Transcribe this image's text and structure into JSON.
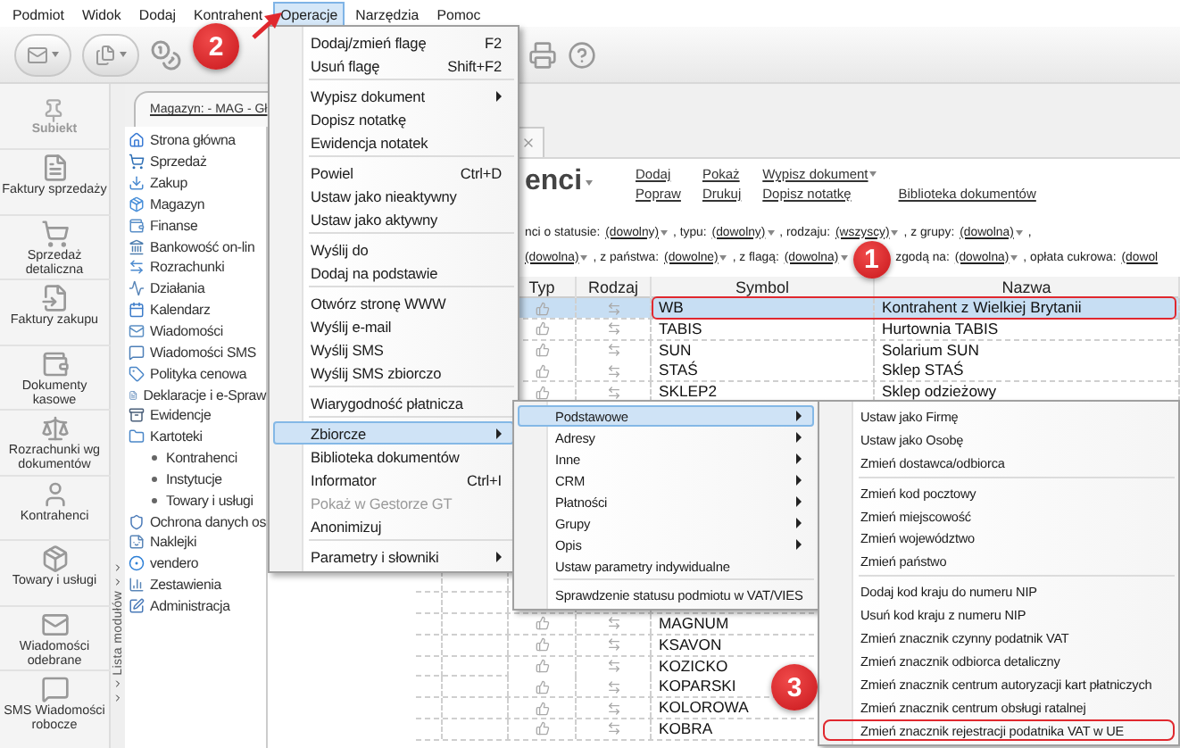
{
  "menu_bar": [
    {
      "label": "Podmiot",
      "selected": false
    },
    {
      "label": "Widok",
      "selected": false
    },
    {
      "label": "Dodaj",
      "selected": false
    },
    {
      "label": "Kontrahent",
      "selected": false
    },
    {
      "label": "Operacje",
      "selected": true
    },
    {
      "label": "Narzędzia",
      "selected": false
    },
    {
      "label": "Pomoc",
      "selected": false
    }
  ],
  "sidebar": {
    "logo_text": "Subiekt",
    "items": [
      {
        "label": "Faktury sprzedaży"
      },
      {
        "label": "Sprzedaż detaliczna"
      },
      {
        "label": "Faktury zakupu"
      },
      {
        "label": "Dokumenty kasowe"
      },
      {
        "label": "Rozrachunki wg dokumentów"
      },
      {
        "label": "Kontrahenci"
      },
      {
        "label": "Towary i usługi"
      },
      {
        "label": "Wiadomości odebrane"
      },
      {
        "label": "SMS Wiadomości robocze"
      }
    ]
  },
  "module_strip": {
    "label": "Lista modułów"
  },
  "tab": {
    "label": "Magazyn: - MAG - Gł"
  },
  "module_tree": [
    {
      "label": "Strona główna"
    },
    {
      "label": "Sprzedaż"
    },
    {
      "label": "Zakup"
    },
    {
      "label": "Magazyn"
    },
    {
      "label": "Finanse"
    },
    {
      "label": "Bankowość on-lin"
    },
    {
      "label": "Rozrachunki"
    },
    {
      "label": "Działania"
    },
    {
      "label": "Kalendarz"
    },
    {
      "label": "Wiadomości"
    },
    {
      "label": "Wiadomości SMS"
    },
    {
      "label": "Polityka cenowa"
    },
    {
      "label": "Deklaracje i e-Spraw"
    },
    {
      "label": "Ewidencje"
    },
    {
      "label": "Kartoteki",
      "children": [
        {
          "label": "Kontrahenci"
        },
        {
          "label": "Instytucje"
        },
        {
          "label": "Towary i usługi"
        }
      ]
    },
    {
      "label": "Ochrona danych os"
    },
    {
      "label": "Naklejki"
    },
    {
      "label": "vendero"
    },
    {
      "label": "Zestawienia"
    },
    {
      "label": "Administracja"
    }
  ],
  "content": {
    "title": "enci",
    "action_columns": [
      [
        {
          "label": "Dodaj",
          "dropdown": false
        },
        {
          "label": "Popraw",
          "dropdown": false
        }
      ],
      [
        {
          "label": "Pokaż",
          "dropdown": false
        },
        {
          "label": "Drukuj",
          "dropdown": false
        }
      ],
      [
        {
          "label": "Wypisz dokument",
          "dropdown": true
        },
        {
          "label": "Dopisz notatkę",
          "dropdown": false
        }
      ],
      [
        {
          "label": "Biblioteka dokumentów",
          "dropdown": false
        }
      ]
    ],
    "filters": [
      [
        {
          "kind": "text",
          "text": "nci o statusie:"
        },
        {
          "kind": "dropdown",
          "text": "(dowolny)"
        },
        {
          "kind": "text",
          "text": ", typu:"
        },
        {
          "kind": "dropdown",
          "text": "(dowolny)"
        },
        {
          "kind": "text",
          "text": ", rodzaju:"
        },
        {
          "kind": "dropdown",
          "text": "(wszyscy)"
        },
        {
          "kind": "text",
          "text": ", z grupy:"
        },
        {
          "kind": "dropdown",
          "text": "(dowolna)"
        },
        {
          "kind": "text",
          "text": ","
        }
      ],
      [
        {
          "kind": "dropdown",
          "text": "(dowolna)"
        },
        {
          "kind": "text",
          "text": ", z państwa:"
        },
        {
          "kind": "dropdown",
          "text": "(dowolne)"
        },
        {
          "kind": "text",
          "text": ", z flagą:"
        },
        {
          "kind": "dropdown",
          "text": "(dowolna)"
        },
        {
          "kind": "callout",
          "label": "1"
        },
        {
          "kind": "text",
          "text": "zgodą na:"
        },
        {
          "kind": "dropdown",
          "text": "(dowolna)"
        },
        {
          "kind": "text",
          "text": ", opłata cukrowa:"
        },
        {
          "kind": "value",
          "text": "(dowol"
        }
      ]
    ]
  },
  "table": {
    "columns": [
      "Typ",
      "Rodzaj",
      "Symbol",
      "Nazwa"
    ],
    "row_groups": [
      [
        {
          "symbol": "WB",
          "name": "Kontrahent z Wielkiej Brytanii",
          "selected": true,
          "outlined": true
        },
        {
          "symbol": "TABIS",
          "name": "Hurtownia TABIS",
          "selected": false,
          "outlined": false
        },
        {
          "symbol": "SUN",
          "name": "Solarium SUN",
          "selected": false,
          "outlined": false
        },
        {
          "symbol": "STAŚ",
          "name": "Sklep STAŚ",
          "selected": false,
          "outlined": false
        },
        {
          "symbol": "SKLEP2",
          "name": "Sklep odzieżowy",
          "selected": false,
          "outlined": false
        }
      ],
      [
        {
          "symbol": "MAGNUM",
          "selected": false,
          "outlined": false
        },
        {
          "symbol": "KSAVON",
          "selected": false,
          "outlined": false
        },
        {
          "symbol": "KOZICKO",
          "selected": false,
          "outlined": false
        },
        {
          "symbol": "KOPARSKI",
          "selected": false,
          "outlined": false
        },
        {
          "symbol": "KOLOROWA",
          "selected": false,
          "outlined": false
        },
        {
          "symbol": "KOBRA",
          "selected": false,
          "outlined": false
        }
      ]
    ]
  },
  "operacje_menu": [
    {
      "kind": "item",
      "label": "Dodaj/zmień flagę",
      "shortcut": "F2",
      "submenu": false,
      "selected": false,
      "disabled": false
    },
    {
      "kind": "item",
      "label": "Usuń flagę",
      "shortcut": "Shift+F2",
      "submenu": false,
      "selected": false,
      "disabled": false
    },
    {
      "kind": "separator"
    },
    {
      "kind": "item",
      "label": "Wypisz dokument",
      "submenu": true,
      "selected": false,
      "disabled": false
    },
    {
      "kind": "item",
      "label": "Dopisz notatkę",
      "submenu": false,
      "selected": false,
      "disabled": false
    },
    {
      "kind": "item",
      "label": "Ewidencja notatek",
      "submenu": false,
      "selected": false,
      "disabled": false
    },
    {
      "kind": "separator"
    },
    {
      "kind": "item",
      "label": "Powiel",
      "shortcut": "Ctrl+D",
      "submenu": false,
      "selected": false,
      "disabled": false
    },
    {
      "kind": "item",
      "label": "Ustaw jako nieaktywny",
      "submenu": false,
      "selected": false,
      "disabled": false
    },
    {
      "kind": "item",
      "label": "Ustaw jako aktywny",
      "submenu": false,
      "selected": false,
      "disabled": false
    },
    {
      "kind": "separator"
    },
    {
      "kind": "item",
      "label": "Wyślij do",
      "submenu": false,
      "selected": false,
      "disabled": false
    },
    {
      "kind": "item",
      "label": "Dodaj na podstawie",
      "submenu": false,
      "selected": false,
      "disabled": false
    },
    {
      "kind": "separator"
    },
    {
      "kind": "item",
      "label": "Otwórz stronę WWW",
      "submenu": false,
      "selected": false,
      "disabled": false
    },
    {
      "kind": "item",
      "label": "Wyślij e-mail",
      "submenu": false,
      "selected": false,
      "disabled": false
    },
    {
      "kind": "item",
      "label": "Wyślij SMS",
      "submenu": false,
      "selected": false,
      "disabled": false
    },
    {
      "kind": "item",
      "label": "Wyślij SMS zbiorczo",
      "submenu": false,
      "selected": false,
      "disabled": false
    },
    {
      "kind": "separator"
    },
    {
      "kind": "item",
      "label": "Wiarygodność płatnicza",
      "submenu": false,
      "selected": false,
      "disabled": false
    },
    {
      "kind": "separator"
    },
    {
      "kind": "item",
      "label": "Zbiorcze",
      "submenu": true,
      "selected": true,
      "disabled": false
    },
    {
      "kind": "item",
      "label": "Biblioteka dokumentów",
      "submenu": false,
      "selected": false,
      "disabled": false
    },
    {
      "kind": "item",
      "label": "Informator",
      "shortcut": "Ctrl+I",
      "submenu": false,
      "selected": false,
      "disabled": false
    },
    {
      "kind": "item",
      "label": "Pokaż w Gestorze GT",
      "submenu": false,
      "selected": false,
      "disabled": true
    },
    {
      "kind": "item",
      "label": "Anonimizuj",
      "submenu": false,
      "selected": false,
      "disabled": false
    },
    {
      "kind": "separator"
    },
    {
      "kind": "item",
      "label": "Parametry i słowniki",
      "submenu": true,
      "selected": false,
      "disabled": false
    }
  ],
  "zbiorcze_menu": [
    {
      "kind": "item",
      "label": "Podstawowe",
      "submenu": true,
      "selected": true
    },
    {
      "kind": "item",
      "label": "Adresy",
      "submenu": true,
      "selected": false
    },
    {
      "kind": "item",
      "label": "Inne",
      "submenu": true,
      "selected": false
    },
    {
      "kind": "item",
      "label": "CRM",
      "submenu": true,
      "selected": false
    },
    {
      "kind": "item",
      "label": "Płatności",
      "submenu": true,
      "selected": false
    },
    {
      "kind": "item",
      "label": "Grupy",
      "submenu": true,
      "selected": false
    },
    {
      "kind": "item",
      "label": "Opis",
      "submenu": true,
      "selected": false
    },
    {
      "kind": "item",
      "label": "Ustaw parametry indywidualne",
      "submenu": false,
      "selected": false
    },
    {
      "kind": "separator"
    },
    {
      "kind": "item",
      "label": "Sprawdzenie statusu podmiotu w VAT/VIES",
      "submenu": false,
      "selected": false
    }
  ],
  "podstawowe_menu": [
    {
      "kind": "item",
      "label": "Ustaw jako Firmę",
      "outlined": false
    },
    {
      "kind": "item",
      "label": "Ustaw jako Osobę",
      "outlined": false
    },
    {
      "kind": "item",
      "label": "Zmień dostawca/odbiorca",
      "outlined": false
    },
    {
      "kind": "separator"
    },
    {
      "kind": "item",
      "label": "Zmień kod pocztowy",
      "outlined": false
    },
    {
      "kind": "item",
      "label": "Zmień miejscowość",
      "outlined": false
    },
    {
      "kind": "item",
      "label": "Zmień województwo",
      "outlined": false
    },
    {
      "kind": "item",
      "label": "Zmień państwo",
      "outlined": false
    },
    {
      "kind": "separator"
    },
    {
      "kind": "item",
      "label": "Dodaj kod kraju do numeru NIP",
      "outlined": false
    },
    {
      "kind": "item",
      "label": "Usuń kod kraju z numeru NIP",
      "outlined": false
    },
    {
      "kind": "item",
      "label": "Zmień znacznik czynny podatnik VAT",
      "outlined": false
    },
    {
      "kind": "item",
      "label": "Zmień znacznik odbiorca detaliczny",
      "outlined": false
    },
    {
      "kind": "item",
      "label": "Zmień znacznik centrum autoryzacji kart płatniczych",
      "outlined": false
    },
    {
      "kind": "item",
      "label": "Zmień znacznik centrum obsługi ratalnej",
      "outlined": false
    },
    {
      "kind": "item",
      "label": "Zmień znacznik rejestracji podatnika VAT w UE",
      "outlined": true
    }
  ],
  "callouts": [
    {
      "label": "2"
    },
    {
      "label": "3"
    }
  ]
}
